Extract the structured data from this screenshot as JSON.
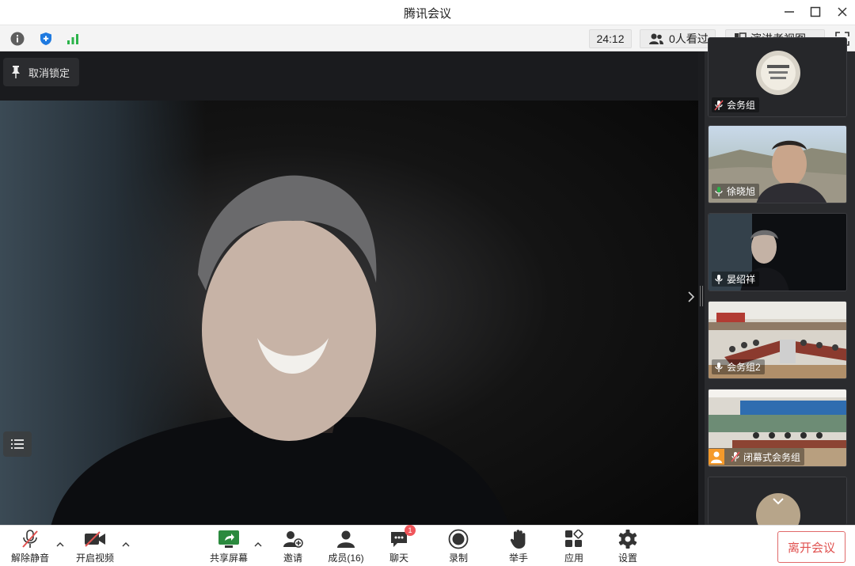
{
  "window": {
    "title": "腾讯会议"
  },
  "infobar": {
    "timer": "24:12",
    "viewers": "0人看过",
    "view_mode": "演讲者视图"
  },
  "stage": {
    "unlock_label": "取消锁定"
  },
  "participants": [
    {
      "name": "会务组",
      "mic": "muted"
    },
    {
      "name": "徐晓旭",
      "mic": "active"
    },
    {
      "name": "晏绍祥",
      "mic": "active"
    },
    {
      "name": "会务组2",
      "mic": "active"
    },
    {
      "name": "闭幕式会务组",
      "mic": "muted",
      "host": true
    }
  ],
  "toolbar": {
    "unmute": "解除静音",
    "start_video": "开启视频",
    "share_screen": "共享屏幕",
    "invite": "邀请",
    "members": "成员(16)",
    "chat": "聊天",
    "chat_badge": "1",
    "record": "录制",
    "raise_hand": "举手",
    "apps": "应用",
    "settings": "设置",
    "leave": "离开会议"
  },
  "colors": {
    "accent_green": "#2bb34a",
    "shield_blue": "#1f7ae0",
    "leave_red": "#e0514f",
    "badge_red": "#f0565b"
  }
}
